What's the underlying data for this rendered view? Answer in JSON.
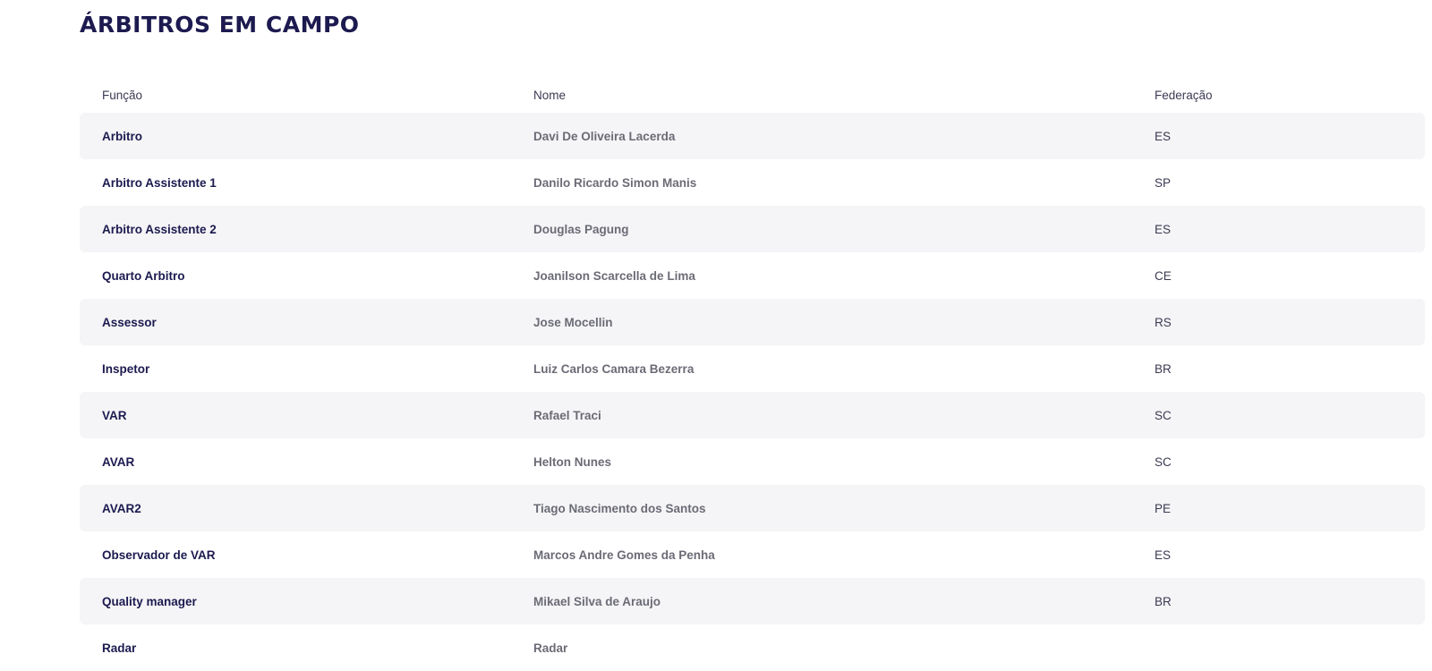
{
  "section": {
    "title": "ÁRBITROS EM CAMPO"
  },
  "table": {
    "headers": {
      "funcao": "Função",
      "nome": "Nome",
      "federacao": "Federação"
    },
    "rows": [
      {
        "funcao": "Arbitro",
        "nome": "Davi De Oliveira Lacerda",
        "federacao": "ES"
      },
      {
        "funcao": "Arbitro Assistente 1",
        "nome": "Danilo Ricardo Simon Manis",
        "federacao": "SP"
      },
      {
        "funcao": "Arbitro Assistente 2",
        "nome": "Douglas Pagung",
        "federacao": "ES"
      },
      {
        "funcao": "Quarto Arbitro",
        "nome": "Joanilson Scarcella de Lima",
        "federacao": "CE"
      },
      {
        "funcao": "Assessor",
        "nome": "Jose Mocellin",
        "federacao": "RS"
      },
      {
        "funcao": "Inspetor",
        "nome": "Luiz Carlos Camara Bezerra",
        "federacao": "BR"
      },
      {
        "funcao": "VAR",
        "nome": "Rafael Traci",
        "federacao": "SC"
      },
      {
        "funcao": "AVAR",
        "nome": "Helton Nunes",
        "federacao": "SC"
      },
      {
        "funcao": "AVAR2",
        "nome": "Tiago Nascimento dos Santos",
        "federacao": "PE"
      },
      {
        "funcao": "Observador de VAR",
        "nome": "Marcos Andre Gomes da Penha",
        "federacao": "ES"
      },
      {
        "funcao": "Quality manager",
        "nome": "Mikael Silva de Araujo",
        "federacao": "BR"
      },
      {
        "funcao": "Radar",
        "nome": "Radar",
        "federacao": ""
      }
    ]
  }
}
